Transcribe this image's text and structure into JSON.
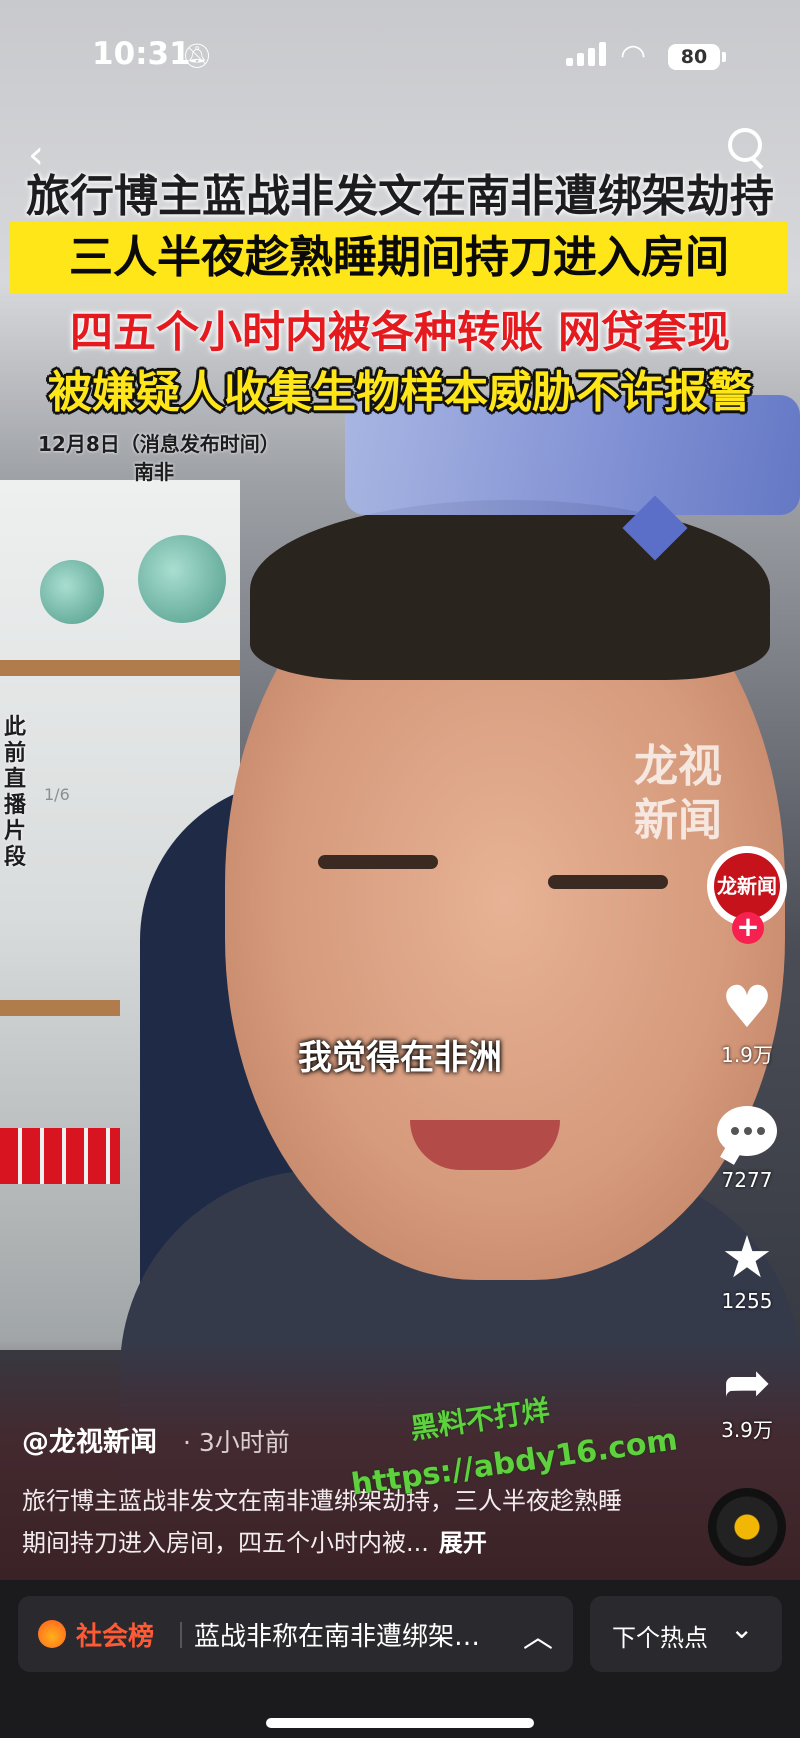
{
  "status_bar": {
    "time": "10:31",
    "battery": "80"
  },
  "headlines": {
    "line1": "旅行博主蓝战非发文在南非遭绑架劫持",
    "line2": "三人半夜趁熟睡期间持刀进入房间",
    "line3": "四五个小时内被各种转账 网贷套现",
    "line4": "被嫌疑人收集生物样本威胁不许报警"
  },
  "video_overlay": {
    "date": "12月8日（消息发布时间）",
    "place": "南非",
    "vertical_label": "此前直播片段",
    "pager": "1/6",
    "watermark": "龙视新闻",
    "subtitle": "我觉得在非洲"
  },
  "creator": {
    "avatar_text": "龙新闻"
  },
  "actions": {
    "likes": "1.9万",
    "comments": "7277",
    "favorites": "1255",
    "shares": "3.9万"
  },
  "post": {
    "author": "@龙视新闻",
    "time_ago": "· 3小时前",
    "description": "旅行博主蓝战非发文在南非遭绑架劫持，三人半夜趁熟睡期间持刀进入房间，四五个小时内被...",
    "expand": "展开"
  },
  "overlay_watermark": {
    "line1": "黑料不打烊",
    "line2": "https://abdy16.com"
  },
  "hot_bar": {
    "category": "社会榜",
    "title": "蓝战非称在南非遭绑架…",
    "next_label": "下个热点"
  },
  "icons": {
    "back": "chevron-left-icon",
    "search": "search-icon",
    "like": "heart-icon",
    "comment": "comment-icon",
    "favorite": "star-icon",
    "share": "share-icon"
  },
  "colors": {
    "headline_yellow": "#ffe619",
    "headline_red": "#e41a1e",
    "hot_accent": "#ff5a36",
    "follow_pink": "#f7214f"
  }
}
